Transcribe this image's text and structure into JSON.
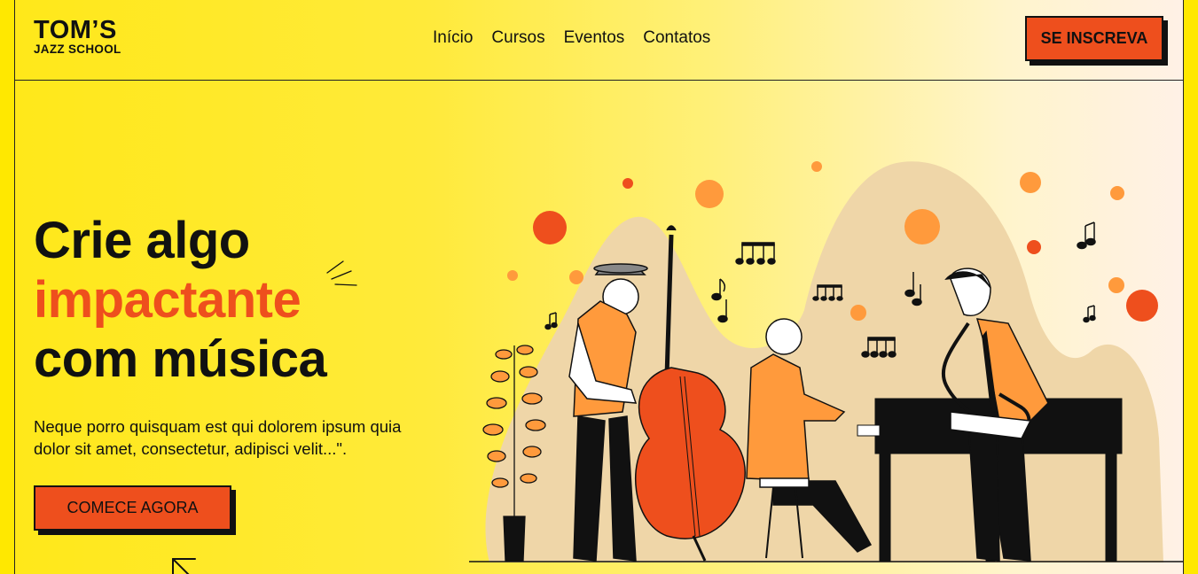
{
  "brand": {
    "name": "TOM’S",
    "tagline": "JAZZ SCHOOL"
  },
  "nav": {
    "items": [
      {
        "label": "Início"
      },
      {
        "label": "Cursos"
      },
      {
        "label": "Eventos"
      },
      {
        "label": "Contatos"
      }
    ]
  },
  "header": {
    "signup_label": "SE INSCREVA"
  },
  "hero": {
    "title_line1": "Crie algo",
    "title_accent": "impactante",
    "title_line3": "com música",
    "description": "Neque porro quisquam est qui dolorem ipsum quia dolor sit amet, consectetur, adipisci velit...\".",
    "cta_label": "COMECE AGORA"
  },
  "colors": {
    "accent": "#EE4F1D",
    "background": "#FFE800",
    "text": "#111111",
    "illustration_orange": "#FF9A3C",
    "illustration_beige": "#EFD6A8"
  },
  "icons": {
    "sparkle": "sparkle-lines-icon",
    "cursor": "arrow-cursor-icon",
    "music": "music-note-icon"
  }
}
